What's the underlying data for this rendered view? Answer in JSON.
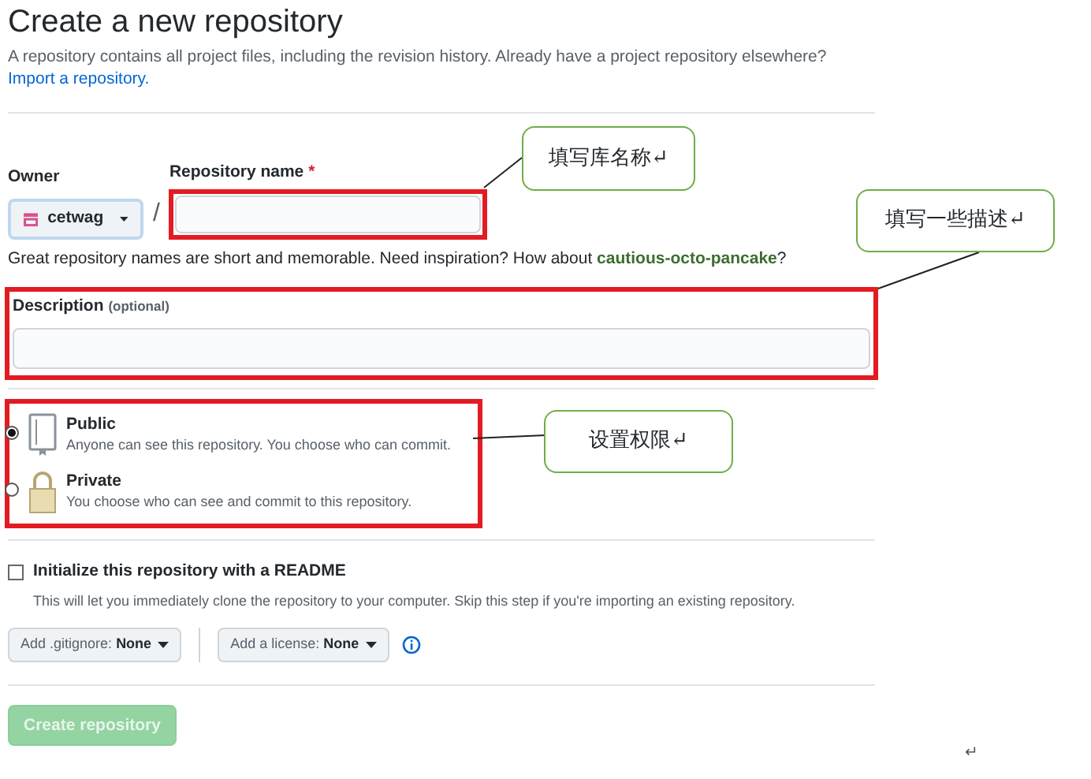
{
  "header": {
    "title": "Create a new repository",
    "description": "A repository contains all project files, including the revision history. Already have a project repository elsewhere?",
    "import_link": "Import a repository."
  },
  "owner": {
    "label": "Owner",
    "value": "cetwag"
  },
  "separator": "/",
  "repo_name": {
    "label": "Repository name",
    "required_mark": "*",
    "hint": "Great repository names are short and memorable. Need inspiration? How about ",
    "suggestion": "cautious-octo-pancake",
    "hint_end": "?"
  },
  "description_field": {
    "label": "Description",
    "optional": "(optional)"
  },
  "visibility": [
    {
      "kind": "public",
      "label": "Public",
      "description": "Anyone can see this repository. You choose who can commit.",
      "selected": true
    },
    {
      "kind": "private",
      "label": "Private",
      "description": "You choose who can see and commit to this repository.",
      "selected": false
    }
  ],
  "readme": {
    "label": "Initialize this repository with a README",
    "description": "This will let you immediately clone the repository to your computer. Skip this step if you're importing an existing repository.",
    "checked": false
  },
  "gitignore": {
    "label": "Add .gitignore:",
    "value": "None"
  },
  "license": {
    "label": "Add a license:",
    "value": "None"
  },
  "create_button": {
    "label": "Create repository",
    "disabled": true
  },
  "callouts": [
    {
      "text": "填写库名称↵"
    },
    {
      "text": "填写一些描述↵"
    },
    {
      "text": "设置权限↵"
    }
  ],
  "paragraph_mark": "↵"
}
